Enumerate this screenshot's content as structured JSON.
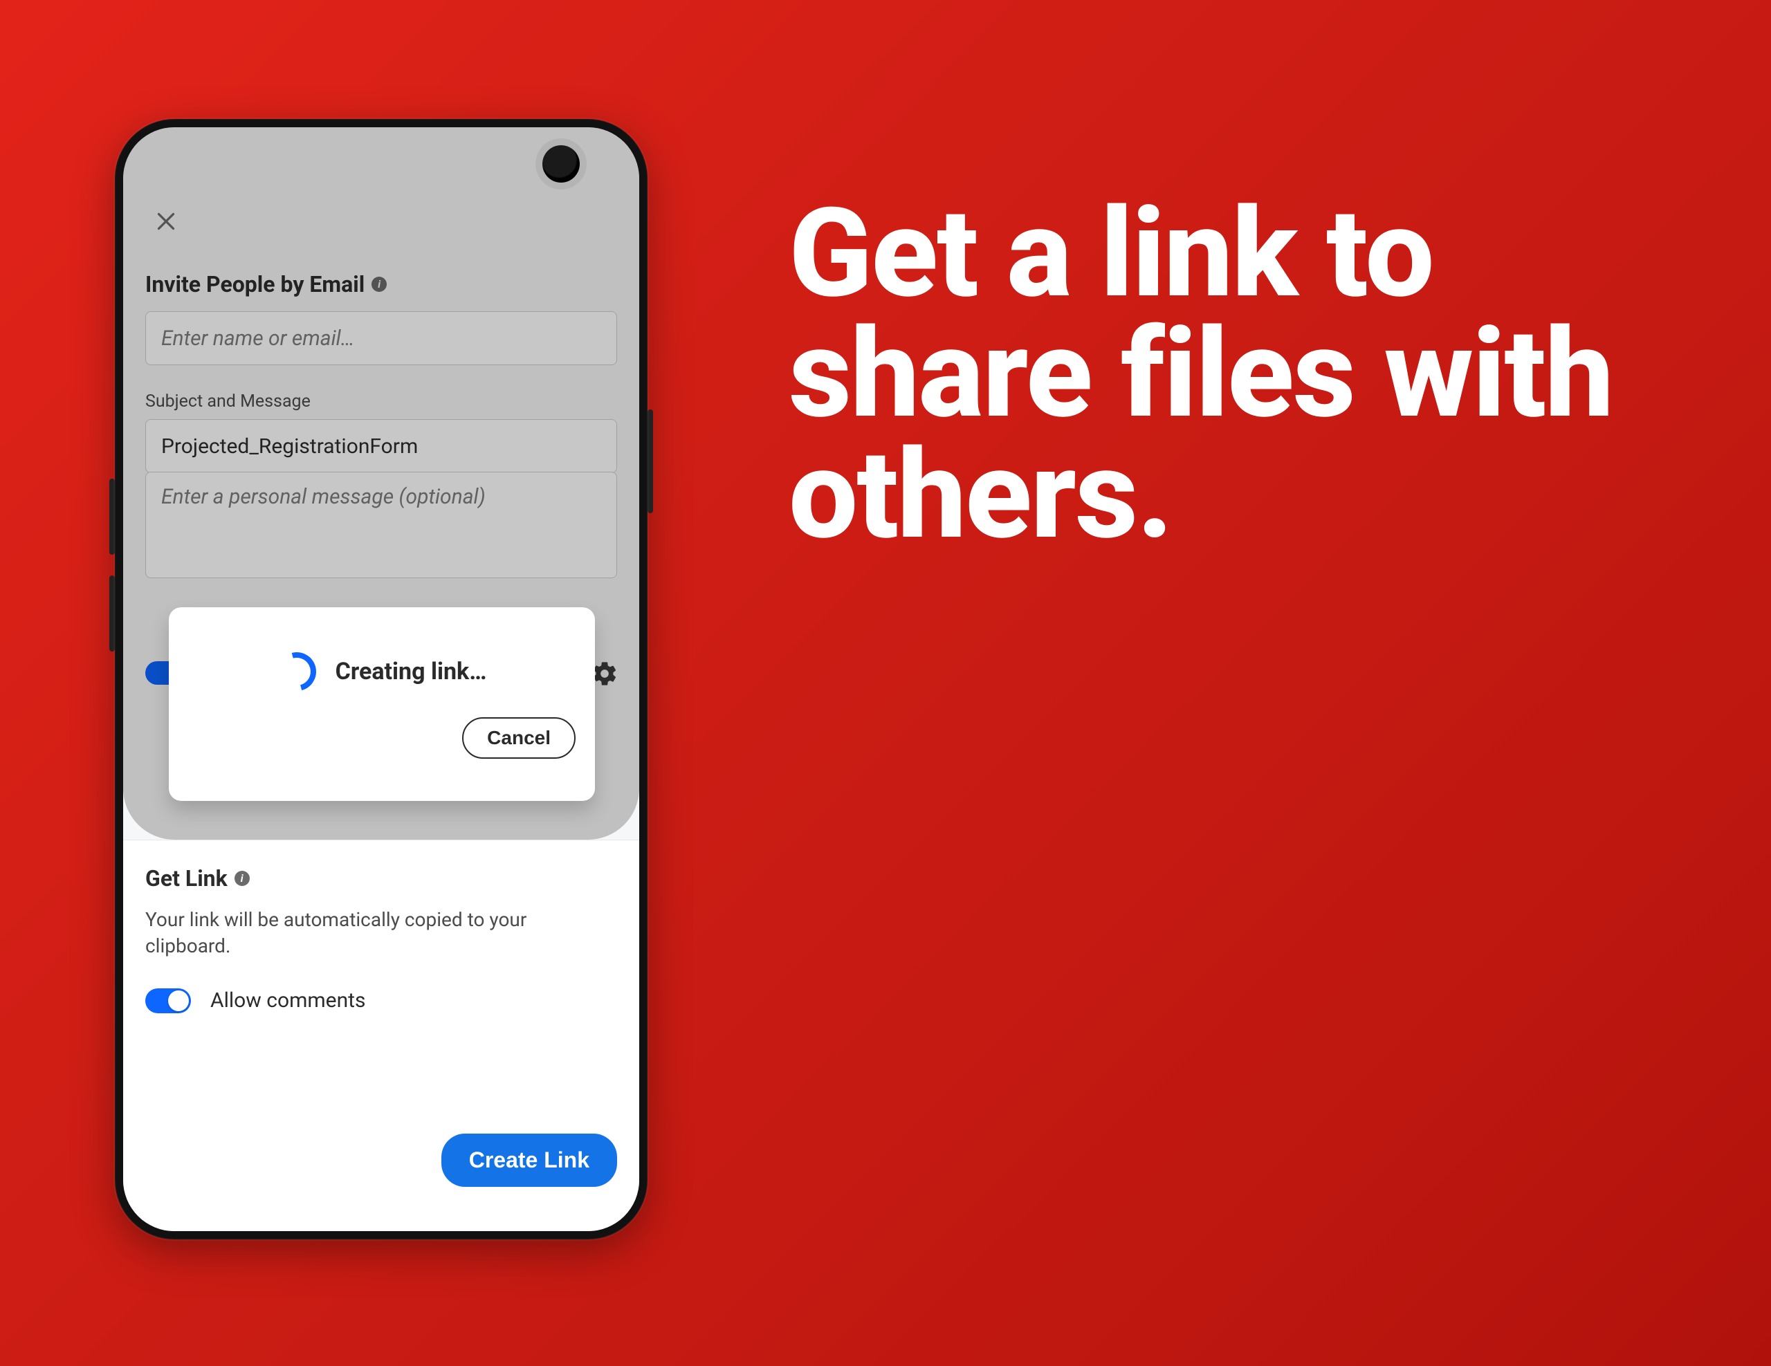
{
  "headline": "Get a link to share files with others.",
  "share": {
    "invite_label": "Invite People by Email",
    "email_placeholder": "Enter name or email…",
    "subject_label": "Subject and Message",
    "subject_value": "Projected_RegistrationForm",
    "message_placeholder": "Enter a personal message (optional)"
  },
  "modal": {
    "status_text": "Creating link…",
    "cancel_label": "Cancel"
  },
  "getlink": {
    "title": "Get Link",
    "description": "Your link will be automatically copied to your clipboard.",
    "allow_comments_label": "Allow comments",
    "allow_comments_on": true,
    "create_label": "Create Link"
  },
  "colors": {
    "accent": "#1473e6"
  }
}
